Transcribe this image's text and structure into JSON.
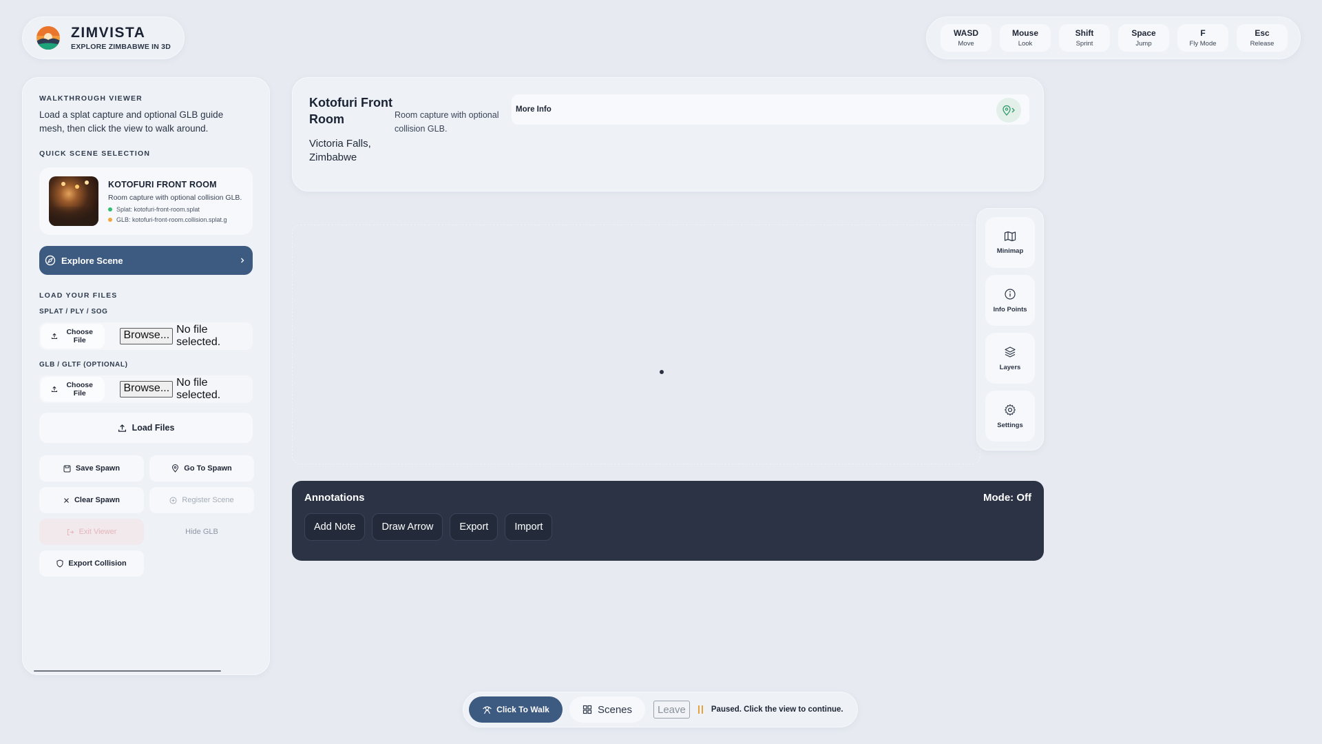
{
  "brand": {
    "title": "ZIMVISTA",
    "subtitle": "EXPLORE ZIMBABWE IN 3D"
  },
  "controls": [
    {
      "key": "WASD",
      "action": "Move"
    },
    {
      "key": "Mouse",
      "action": "Look"
    },
    {
      "key": "Shift",
      "action": "Sprint"
    },
    {
      "key": "Space",
      "action": "Jump"
    },
    {
      "key": "F",
      "action": "Fly Mode"
    },
    {
      "key": "Esc",
      "action": "Release"
    }
  ],
  "sidebar": {
    "viewer_heading": "WALKTHROUGH VIEWER",
    "intro": "Load a splat capture and optional GLB guide mesh, then click the view to walk around.",
    "quick_heading": "QUICK SCENE SELECTION",
    "scene": {
      "name": "KOTOFURI FRONT ROOM",
      "description": "Room capture with optional collision GLB.",
      "splat_file": "Splat: kotofuri-front-room.splat",
      "glb_file": "GLB: kotofuri-front-room.collision.splat.g"
    },
    "explore_label": "Explore Scene",
    "load_heading": "LOAD YOUR FILES",
    "splat_label": "SPLAT / PLY / SOG",
    "glb_label": "GLB / GLTF (OPTIONAL)",
    "choose_file": "Choose File",
    "browse": "Browse...",
    "no_file": "No file selected.",
    "load_files": "Load Files",
    "buttons": {
      "save_spawn": "Save Spawn",
      "go_to_spawn": "Go To Spawn",
      "clear_spawn": "Clear Spawn",
      "register_scene": "Register Scene",
      "exit_viewer": "Exit Viewer",
      "hide_glb": "Hide GLB",
      "export_collision": "Export Collision"
    }
  },
  "location": {
    "title": "Kotofuri Front Room",
    "place": "Victoria Falls, Zimbabwe",
    "description": "Room capture with optional collision GLB.",
    "more_info": "More Info"
  },
  "tools": [
    {
      "label": "Minimap",
      "icon": "map-icon"
    },
    {
      "label": "Info Points",
      "icon": "info-icon"
    },
    {
      "label": "Layers",
      "icon": "layers-icon"
    },
    {
      "label": "Settings",
      "icon": "gear-icon"
    }
  ],
  "annotations": {
    "title": "Annotations",
    "mode": "Mode: Off",
    "buttons": [
      "Add Note",
      "Draw Arrow",
      "Export",
      "Import"
    ]
  },
  "bottom": {
    "walk": "Click To Walk",
    "scenes": "Scenes",
    "leave": "Leave",
    "status": "Paused. Click the view to continue."
  },
  "colors": {
    "background": "#e7ebf1",
    "accent": "#3d5a80",
    "annotation_bg": "#2b3345",
    "splat_dot": "#2fbf71",
    "glb_dot": "#f2a63b",
    "pause": "#e3a23c"
  }
}
